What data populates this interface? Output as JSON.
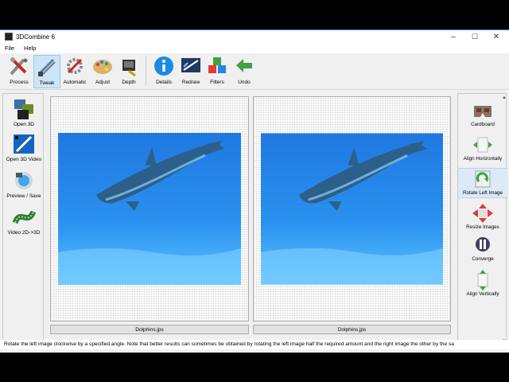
{
  "window": {
    "title": "3DCombine 6",
    "minimize": "–",
    "maximize": "☐",
    "close": "✕"
  },
  "menu": {
    "items": [
      "File",
      "Help"
    ]
  },
  "toolbar": {
    "buttons": [
      {
        "label": "Process",
        "icon": "process-icon"
      },
      {
        "label": "Tweak",
        "icon": "tweak-icon",
        "active": true
      },
      {
        "label": "Automatic",
        "icon": "automatic-icon"
      },
      {
        "label": "Adjust",
        "icon": "palette-icon"
      },
      {
        "label": "Depth",
        "icon": "depth-icon"
      },
      {
        "label": "Details",
        "icon": "info-icon"
      },
      {
        "label": "Redraw",
        "icon": "redraw-icon"
      },
      {
        "label": "Filters",
        "icon": "filters-icon"
      },
      {
        "label": "Undo",
        "icon": "undo-icon"
      }
    ]
  },
  "left_panel": {
    "items": [
      {
        "label": "Open 3D",
        "icon": "open-3d-icon"
      },
      {
        "label": "Open 3D Video",
        "icon": "open-3d-video-icon"
      },
      {
        "label": "Preview / Save",
        "icon": "preview-save-icon"
      },
      {
        "label": "Video 2D->3D",
        "icon": "video-2d-3d-icon"
      }
    ]
  },
  "images": {
    "left_filename": "Dolphins.jps",
    "right_filename": "Dolphins.jps"
  },
  "right_panel": {
    "items": [
      {
        "label": "Cardboard",
        "icon": "cardboard-icon"
      },
      {
        "label": "Align Horizontally",
        "icon": "align-horizontal-icon"
      },
      {
        "label": "Rotate Left Image",
        "icon": "rotate-icon",
        "active": true
      },
      {
        "label": "Resize Images",
        "icon": "resize-icon"
      },
      {
        "label": "Converge",
        "icon": "converge-icon"
      },
      {
        "label": "Align Vertically",
        "icon": "align-vertical-icon"
      }
    ],
    "scroll_up": "▲",
    "scroll_down": "▼"
  },
  "status": {
    "text": "Rotate the left image clockwise by a specified angle. Note that better results can sometimes be obtained by rotating the left image half the required amount and the right image the other by the sa"
  },
  "colors": {
    "accent": "#2b7bd6",
    "water": "#1e88e6",
    "tweak_active": "#cce4f7"
  }
}
